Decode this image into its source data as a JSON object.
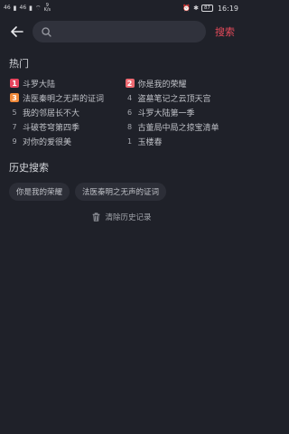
{
  "status_bar": {
    "signal_left": "46",
    "signal_mid": "46",
    "net_speed_top": "9",
    "net_speed_bottom": "K/s",
    "battery": "87",
    "time": "16:19"
  },
  "header": {
    "search_placeholder": "",
    "search_button": "搜索"
  },
  "hot": {
    "title": "热门",
    "items": [
      {
        "rank": "1",
        "label": "斗罗大陆"
      },
      {
        "rank": "2",
        "label": "你是我的荣耀"
      },
      {
        "rank": "3",
        "label": "法医秦明之无声的证词"
      },
      {
        "rank": "4",
        "label": "盗墓笔记之云顶天宫"
      },
      {
        "rank": "5",
        "label": "我的邻居长不大"
      },
      {
        "rank": "6",
        "label": "斗罗大陆第一季"
      },
      {
        "rank": "7",
        "label": "斗破苍穹第四季"
      },
      {
        "rank": "8",
        "label": "古董局中局之掠宝清单"
      },
      {
        "rank": "9",
        "label": "对你的爱很美"
      },
      {
        "rank": "1",
        "label": "玉楼春"
      }
    ]
  },
  "history": {
    "title": "历史搜索",
    "chips": [
      "你是我的荣耀",
      "法医秦明之无声的证词"
    ],
    "clear_label": "清除历史记录"
  },
  "icons": {
    "back": "arrow-left-icon",
    "search": "search-icon",
    "trash": "trash-icon"
  },
  "colors": {
    "accent": "#e64a5a",
    "background": "#1f2129",
    "rank1": "#e8455e",
    "rank2": "#ef6a72",
    "rank3": "#f08a3a"
  }
}
